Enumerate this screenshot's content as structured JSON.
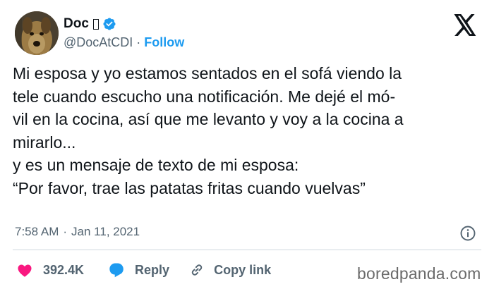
{
  "author": {
    "display_name": "Doc",
    "handle": "@DocAtCDI",
    "separator": "·",
    "follow_label": "Follow"
  },
  "tweet": {
    "text": "Mi esposa y yo estamos sentados en el sofá viendo la\ntele cuando escucho una notificación. Me dejé el mó-\nvil en la cocina, así que me levanto y voy a la cocina a\nmirarlo...\ny es un mensaje de texto de mi esposa:\n“Por favor, trae las patatas fritas cuando vuelvas”",
    "time": "7:58 AM",
    "separator": "·",
    "date": "Jan 11, 2021"
  },
  "actions": {
    "likes_count": "392.4K",
    "reply_label": "Reply",
    "copy_link_label": "Copy link"
  },
  "watermark": "boredpanda.com",
  "colors": {
    "accent": "#1d9bf0",
    "like": "#f91880",
    "text": "#0f1419",
    "secondary": "#536471",
    "divider": "#cfd9de"
  },
  "icons": [
    "verified-badge-icon",
    "x-logo-icon",
    "info-icon",
    "heart-icon",
    "reply-icon",
    "link-icon"
  ]
}
